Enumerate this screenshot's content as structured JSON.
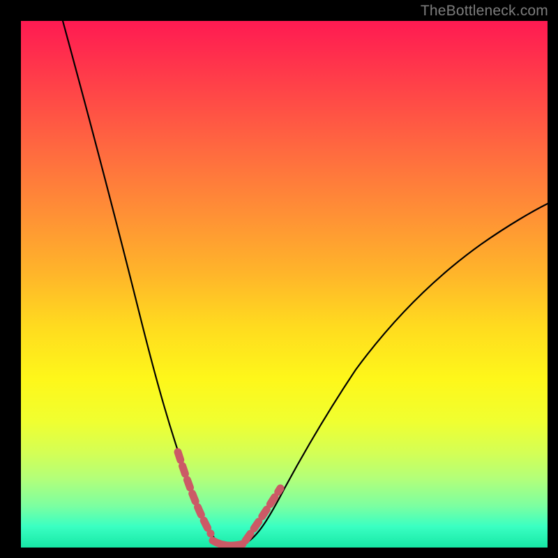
{
  "watermark": "TheBottleneck.com",
  "chart_data": {
    "type": "line",
    "title": "",
    "xlabel": "",
    "ylabel": "",
    "xlim": [
      0,
      100
    ],
    "ylim": [
      0,
      100
    ],
    "series": [
      {
        "name": "bottleneck-curve",
        "x": [
          8,
          12,
          16,
          20,
          24,
          27,
          30,
          32,
          34,
          36,
          38,
          40,
          42,
          46,
          50,
          55,
          60,
          66,
          72,
          80,
          90,
          100
        ],
        "y": [
          100,
          85,
          70,
          56,
          42,
          30,
          19,
          12,
          7,
          3,
          1,
          0,
          1,
          3,
          8,
          14,
          22,
          30,
          38,
          47,
          56,
          62
        ]
      }
    ],
    "highlight_segments": [
      {
        "name": "left-knee-marker",
        "x_range": [
          30,
          36
        ],
        "y_range": [
          3,
          19
        ]
      },
      {
        "name": "right-knee-marker",
        "x_range": [
          42,
          50
        ],
        "y_range": [
          1,
          8
        ]
      },
      {
        "name": "trough-marker",
        "x_range": [
          36,
          42
        ],
        "y_range": [
          0,
          3
        ]
      }
    ],
    "colors": {
      "curve": "#000000",
      "highlight": "#cb5a66"
    }
  }
}
